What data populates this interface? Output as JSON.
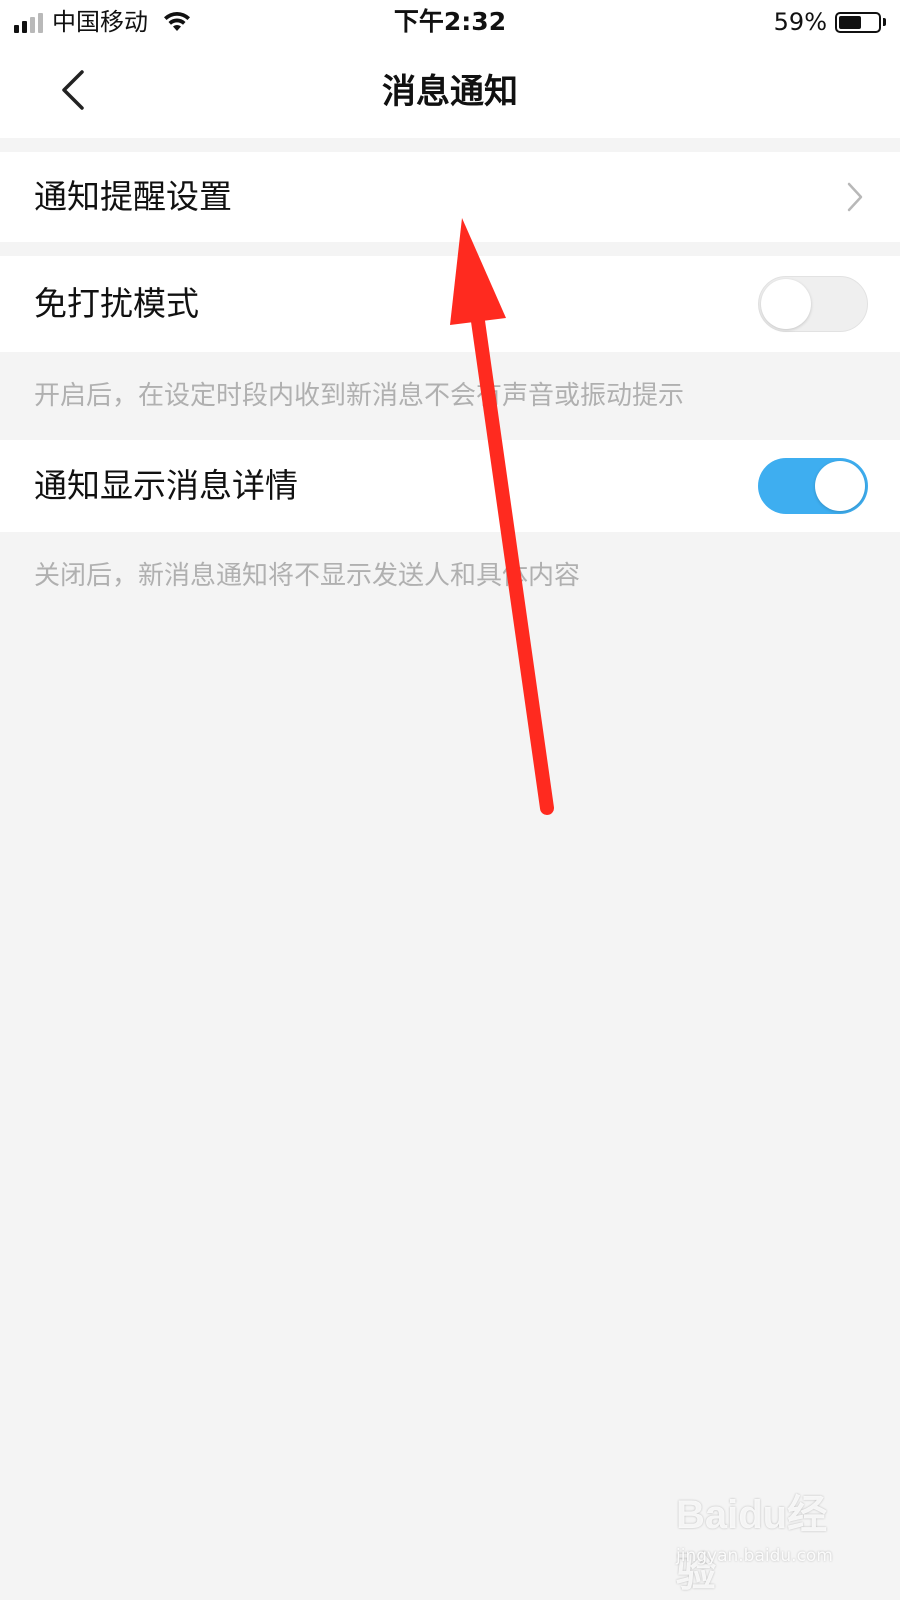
{
  "status_bar": {
    "carrier": "中国移动",
    "time": "下午2:32",
    "battery_percent": "59%",
    "battery_level": 0.59,
    "signal_bars_filled": 2,
    "signal_bars_total": 4,
    "icons": [
      "signal-icon",
      "wifi-icon",
      "battery-icon"
    ]
  },
  "nav": {
    "title": "消息通知",
    "back_icon": "chevron-left-icon"
  },
  "settings": {
    "notify_settings": {
      "label": "通知提醒设置",
      "icon": "chevron-right-icon"
    },
    "do_not_disturb": {
      "label": "免打扰模式",
      "enabled": false,
      "hint": "开启后，在设定时段内收到新消息不会有声音或振动提示"
    },
    "show_details": {
      "label": "通知显示消息详情",
      "enabled": true,
      "hint": "关闭后，新消息通知将不显示发送人和具体内容"
    }
  },
  "annotation": {
    "color": "#ff2a1f",
    "icon": "red-arrow-annotation"
  },
  "watermark": {
    "logo": "Baidu经验",
    "url": "jingyan.baidu.com"
  },
  "colors": {
    "toggle_on": "#3eaef0",
    "toggle_off": "#efefef",
    "page_bg": "#f4f4f4",
    "hint_text": "#b0b0b0"
  }
}
